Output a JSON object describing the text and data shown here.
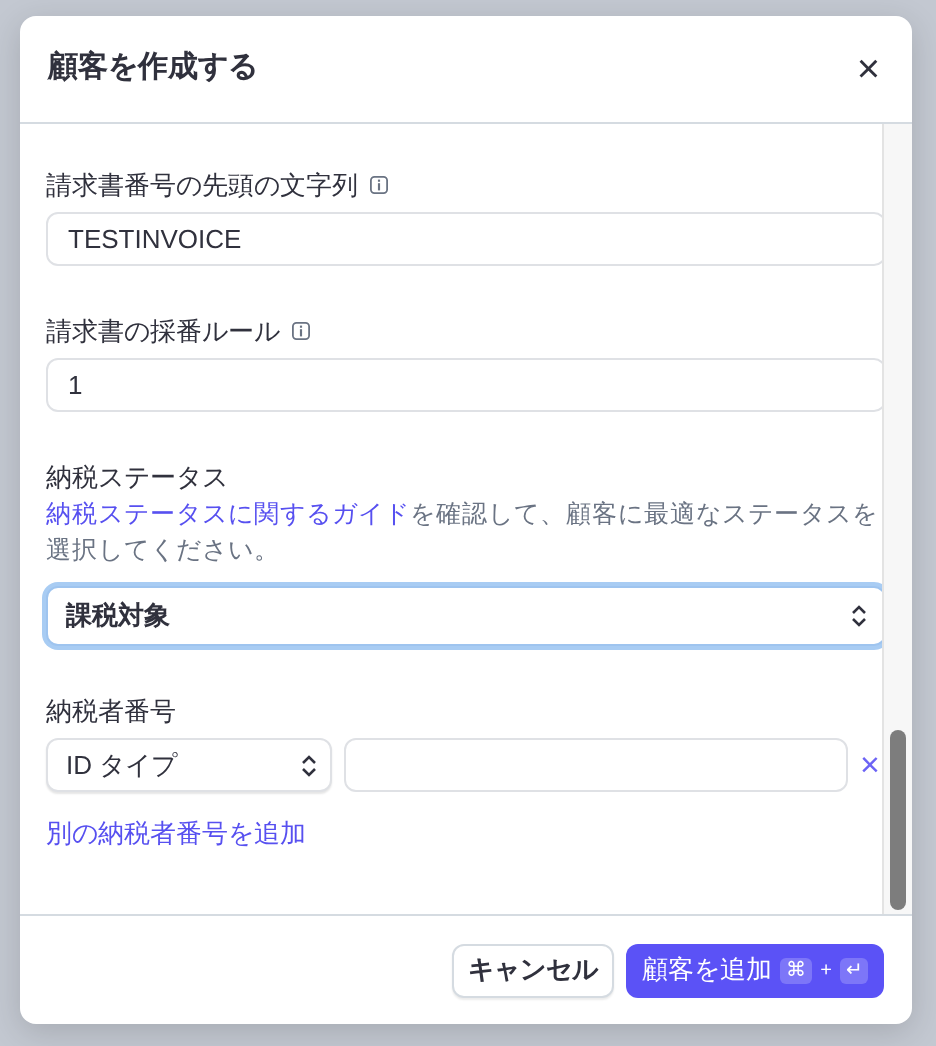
{
  "dialog": {
    "title": "顧客を作成する",
    "close": "×"
  },
  "fields": [
    {
      "kind": "text",
      "label": "請求書番号の先頭の文字列",
      "info": true,
      "value": "TESTINVOICE"
    },
    {
      "kind": "text",
      "label": "請求書の採番ルール",
      "info": true,
      "value": "1"
    },
    {
      "kind": "select",
      "label": "納税ステータス",
      "help_link": "納税ステータスに関するガイド",
      "help_text": "を確認して、顧客に最適なステータスを選択してください。",
      "value": "課税対象",
      "focused": true
    },
    {
      "kind": "taxid",
      "label": "納税者番号",
      "type_value": "ID タイプ",
      "remove": "×",
      "add_link": "別の納税者番号を追加"
    }
  ],
  "footer": {
    "cancel": "キャンセル",
    "submit": "顧客を追加",
    "shortcut": [
      "⌘",
      "+",
      "↵"
    ]
  }
}
